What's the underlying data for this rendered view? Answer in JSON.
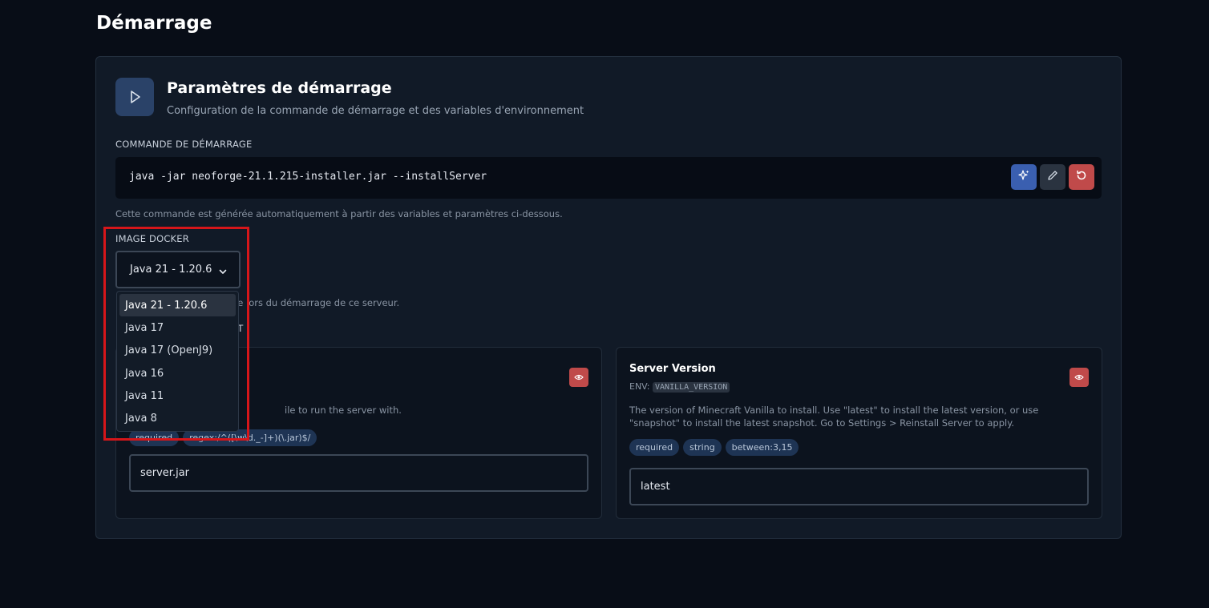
{
  "page": {
    "title": "Démarrage"
  },
  "header": {
    "title": "Paramètres de démarrage",
    "subtitle": "Configuration de la commande de démarrage et des variables d'environnement",
    "icon": "play-icon"
  },
  "command": {
    "label": "COMMANDE DE DÉMARRAGE",
    "text": "java -jar neoforge-21.1.215-installer.jar --installServer",
    "hint": "Cette commande est générée automatiquement à partir des variables et paramètres ci-dessous.",
    "buttons": [
      {
        "icon": "sparkles-icon",
        "color": "#3a5fb0"
      },
      {
        "icon": "pencil-icon",
        "color": "#2a3340"
      },
      {
        "icon": "reset-icon",
        "color": "#c04a4a"
      }
    ]
  },
  "docker": {
    "label": "IMAGE DOCKER",
    "selected": "Java 21 - 1.20.6",
    "hint_partial": "isée lors du démarrage de ce serveur.",
    "options": [
      "Java 21 - 1.20.6",
      "Java 17",
      "Java 17 (OpenJ9)",
      "Java 16",
      "Java 11",
      "Java 8"
    ]
  },
  "variables": {
    "label_partial": "ENT",
    "left": {
      "desc_partial": "ile to run the server with.",
      "tags": [
        "required",
        "regex:/^([\\w\\d._-]+)(\\.jar)$/"
      ],
      "value": "server.jar"
    },
    "right": {
      "title": "Server Version",
      "env_prefix": "ENV:",
      "env": "VANILLA_VERSION",
      "desc": "The version of Minecraft Vanilla to install. Use \"latest\" to install the latest version, or use \"snapshot\" to install the latest snapshot. Go to Settings > Reinstall Server to apply.",
      "tags": [
        "required",
        "string",
        "between:3,15"
      ],
      "value": "latest"
    }
  },
  "colors": {
    "highlight": "#d6161a",
    "accent": "#3a5fb0",
    "danger": "#c04a4a"
  }
}
